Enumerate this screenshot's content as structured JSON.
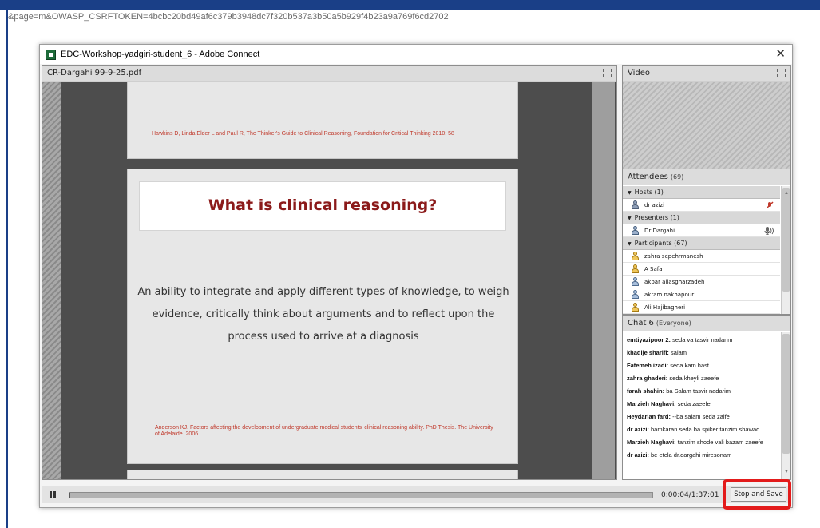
{
  "browser": {
    "url_fragment": "&page=m&OWASP_CSRFTOKEN=4bcbc20bd49af6c379b3948dc7f320b537a3b50a5b929f4b23a9a769f6cd2702",
    "accent_color": "#1a3f87"
  },
  "window": {
    "title": "EDC-Workshop-yadgiri-student_6 - Adobe Connect",
    "close_glyph": "✕"
  },
  "share_pod": {
    "title": "CR-Dargahi 99-9-25.pdf",
    "slide1_reference": "Hawkins D, Linda Elder L and Paul R, The Thinker's Guide to Clinical Reasoning, Foundation for Critical Thinking 2010; 58",
    "slide2": {
      "heading": "What is clinical reasoning?",
      "body": "An ability to integrate and apply different types of knowledge, to weigh evidence, critically think about arguments and to reflect upon the process used to arrive at a diagnosis",
      "reference": "Anderson KJ. Factors affecting the development of undergraduate medical students' clinical reasoning ability. PhD Thesis. The University of Adelaide. 2006"
    }
  },
  "video_pod": {
    "title": "Video"
  },
  "attendees_pod": {
    "title": "Attendees",
    "count": "(69)",
    "groups": [
      {
        "label": "Hosts (1)",
        "people": [
          {
            "name": "dr azizi",
            "role": "host",
            "indicator": "mic-muted"
          }
        ]
      },
      {
        "label": "Presenters (1)",
        "people": [
          {
            "name": "Dr Dargahi",
            "role": "presenter",
            "indicator": "speaking"
          }
        ]
      },
      {
        "label": "Participants (67)",
        "people": [
          {
            "name": "zahra sepehrmanesh",
            "role": "participant"
          },
          {
            "name": "A Safa",
            "role": "participant"
          },
          {
            "name": "akbar aliasgharzadeh",
            "role": "participant-guest"
          },
          {
            "name": "akram nakhapour",
            "role": "participant-guest"
          },
          {
            "name": "Ali Hajibagheri",
            "role": "participant"
          }
        ]
      }
    ]
  },
  "chat_pod": {
    "title": "Chat 6",
    "scope": "(Everyone)",
    "messages": [
      {
        "sender": "emtiyazipoor 2:",
        "text": "seda va tasvir nadarim"
      },
      {
        "sender": "khadije sharifi:",
        "text": "salam"
      },
      {
        "sender": "Fatemeh izadi:",
        "text": "seda kam hast"
      },
      {
        "sender": "zahra ghaderi:",
        "text": "seda kheyli zaeefe"
      },
      {
        "sender": "farah shahin:",
        "text": "ba Salam tasvir nadarim"
      },
      {
        "sender": "Marzieh Naghavi:",
        "text": "seda zaeefe"
      },
      {
        "sender": "Heydarian fard:",
        "text": "--ba salam seda zaife"
      },
      {
        "sender": "dr azizi:",
        "text": "hamkaran seda ba spiker tanzim shawad"
      },
      {
        "sender": "Marzieh Naghavi:",
        "text": "tanzim shode vali bazam zaeefe"
      },
      {
        "sender": "dr azizi:",
        "text": "be etela dr.dargahi miresonam"
      }
    ]
  },
  "playback": {
    "time": "0:00:04/1:37:01",
    "progress_fraction": 0.0007,
    "stop_save_label": "Stop and Save",
    "highlight_color": "#e31b1b"
  }
}
